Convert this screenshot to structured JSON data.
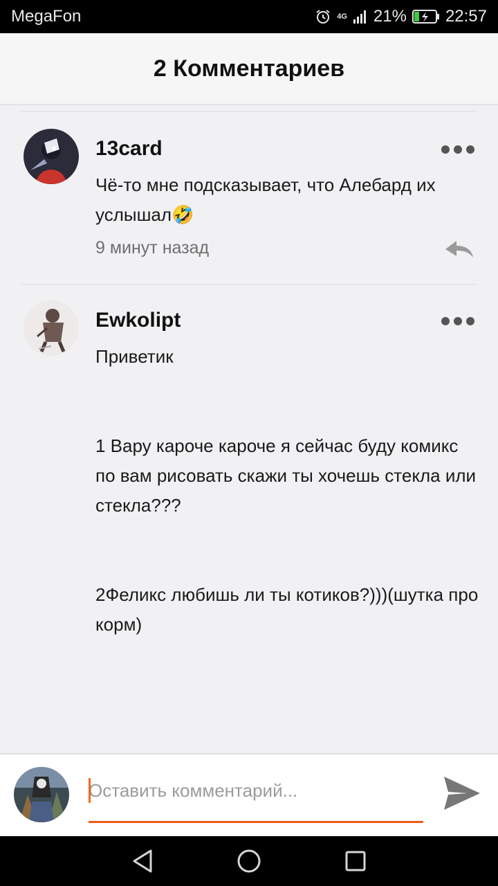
{
  "status_bar": {
    "carrier": "MegaFon",
    "network": "4G",
    "battery": "21%",
    "time": "22:57"
  },
  "header": {
    "title": "2 Комментариев"
  },
  "comments": [
    {
      "author": "13card",
      "text": "Чё-то мне подсказывает, что Алебард их услышал🤣",
      "time": "9 минут назад"
    },
    {
      "author": "Ewkolipt",
      "text": "Приветик\n\n\n1 Вару кароче кароче я сейчас буду комикс по вам рисовать скажи ты хочешь стекла или стекла???\n\n\n2Феликс любишь ли ты котиков?)))(шутка про корм)"
    }
  ],
  "composer": {
    "placeholder": "Оставить комментарий...",
    "accent": "#ef5b16"
  },
  "icons": [
    "alarm-icon",
    "signal-icon",
    "battery-charging-icon",
    "more-icon",
    "reply-icon",
    "send-icon",
    "back-icon",
    "home-icon",
    "recents-icon"
  ]
}
